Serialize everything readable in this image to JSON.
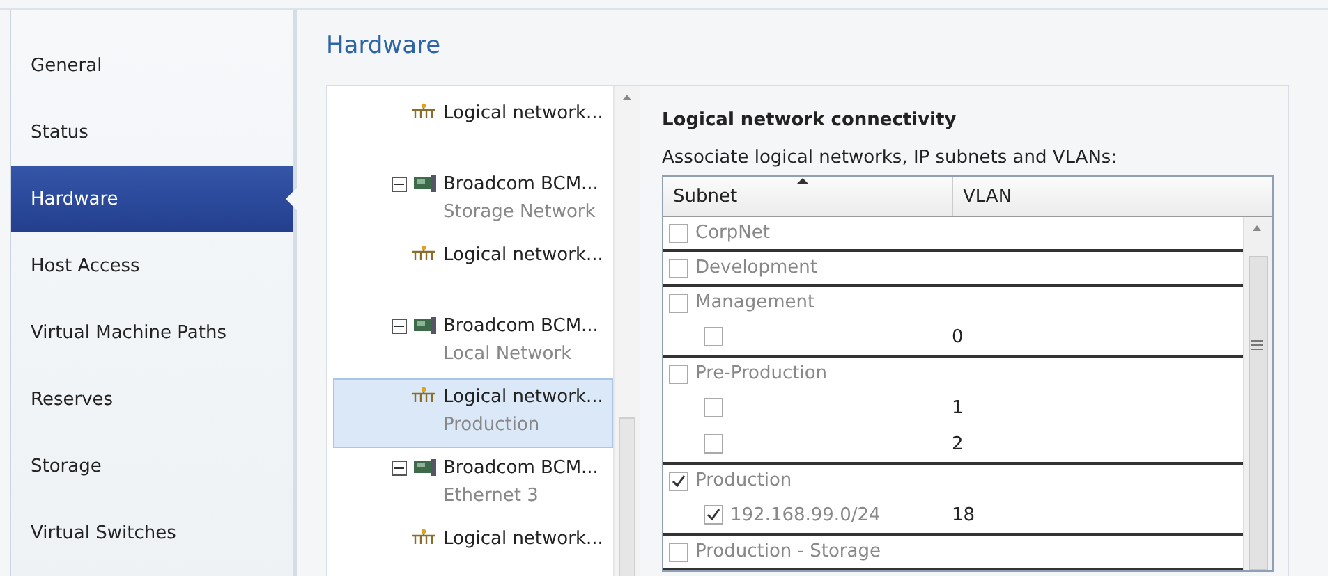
{
  "nav": [
    {
      "label": "General",
      "selected": false
    },
    {
      "label": "Status",
      "selected": false
    },
    {
      "label": "Hardware",
      "selected": true
    },
    {
      "label": "Host Access",
      "selected": false
    },
    {
      "label": "Virtual Machine Paths",
      "selected": false
    },
    {
      "label": "Reserves",
      "selected": false
    },
    {
      "label": "Storage",
      "selected": false
    },
    {
      "label": "Virtual Switches",
      "selected": false
    }
  ],
  "page_title": "Hardware",
  "tree": [
    {
      "kind": "logical",
      "title": "Logical network...",
      "selected": false
    },
    {
      "kind": "adapter",
      "title": "Broadcom BCM...",
      "subtitle": "Storage Network",
      "expanded": true,
      "selected": false
    },
    {
      "kind": "logical",
      "title": "Logical network...",
      "selected": false
    },
    {
      "kind": "adapter",
      "title": "Broadcom BCM...",
      "subtitle": "Local Network",
      "expanded": true,
      "selected": false
    },
    {
      "kind": "logical",
      "title": "Logical network...",
      "subtitle": "Production",
      "selected": true
    },
    {
      "kind": "adapter",
      "title": "Broadcom BCM...",
      "subtitle": "Ethernet 3",
      "expanded": true,
      "selected": false
    },
    {
      "kind": "logical",
      "title": "Logical network...",
      "selected": false
    }
  ],
  "details": {
    "title": "Logical network connectivity",
    "label": "Associate logical networks, IP subnets and VLANs:",
    "columns": [
      {
        "label": "Subnet",
        "sorted": true
      },
      {
        "label": "VLAN",
        "sorted": false
      }
    ],
    "groups": [
      {
        "name": "CorpNet",
        "checked": false
      },
      {
        "name": "Development",
        "checked": false
      },
      {
        "name": "Management",
        "checked": false,
        "subnets": [
          {
            "vlan": "0",
            "checked": false
          }
        ]
      },
      {
        "name": "Pre-Production",
        "checked": false,
        "subnets": [
          {
            "vlan": "1",
            "checked": false
          },
          {
            "vlan": "2",
            "checked": false
          }
        ]
      },
      {
        "name": "Production",
        "checked": true,
        "subnets": [
          {
            "address": "192.168.99.0/24",
            "vlan": "18",
            "checked": true
          }
        ]
      },
      {
        "name": "Production - Storage",
        "checked": false
      }
    ]
  }
}
